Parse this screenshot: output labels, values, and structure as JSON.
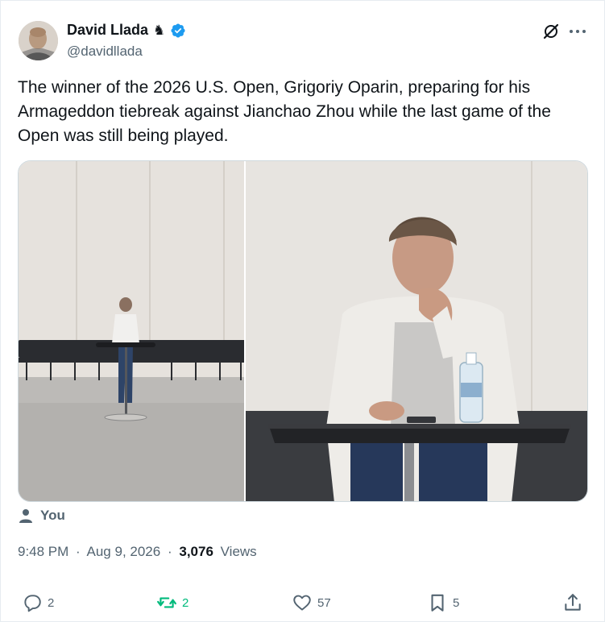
{
  "author": {
    "display_name": "David Llada",
    "badge_glyph": "♞",
    "handle": "@davidllada",
    "verified": true,
    "verified_color": "#1d9bf0"
  },
  "header_actions": {
    "grok_icon": "grok-icon",
    "more_icon": "more-icon"
  },
  "tweet": {
    "text": "The winner of the 2026 U.S. Open, Grigoriy Oparin, preparing for his Armageddon tiebreak against Jianchao Zhou while the last game of the Open was still being played."
  },
  "audience": {
    "label": "You",
    "icon": "person-icon"
  },
  "meta": {
    "time": "9:48 PM",
    "separator": "·",
    "date": "Aug 9, 2026",
    "views_count": "3,076",
    "views_label": "Views"
  },
  "actions": {
    "replies": "2",
    "retweets": "2",
    "likes": "57",
    "bookmarks": "5",
    "retweet_color": "#00ba7c",
    "muted_color": "#536471"
  }
}
